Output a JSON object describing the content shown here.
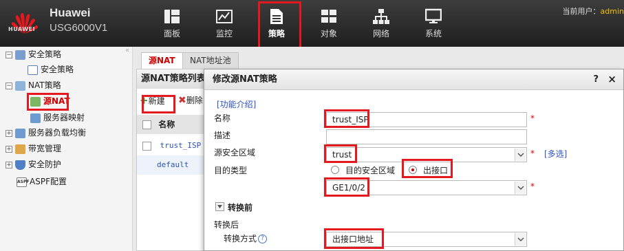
{
  "header": {
    "brand_name": "Huawei",
    "brand_model": "USG6000V1",
    "logo_text": "HUAWEI",
    "current_user_label": "当前用户：",
    "current_user_name": "admin",
    "nav": [
      {
        "label": "面板",
        "icon": "dashboard-icon"
      },
      {
        "label": "监控",
        "icon": "monitor-chart-icon"
      },
      {
        "label": "策略",
        "icon": "policy-document-icon"
      },
      {
        "label": "对象",
        "icon": "objects-icon"
      },
      {
        "label": "网络",
        "icon": "network-icon"
      },
      {
        "label": "系统",
        "icon": "system-computer-icon"
      }
    ],
    "active_nav": "策略",
    "accent_color": "#e41920"
  },
  "sidebar": {
    "collapse_glyph": "«",
    "items": [
      {
        "label": "安全策略",
        "expand": "minus"
      },
      {
        "label": "安全策略"
      },
      {
        "label": "NAT策略",
        "expand": "minus"
      },
      {
        "label": "源NAT"
      },
      {
        "label": "服务器映射"
      },
      {
        "label": "服务器负载均衡",
        "expand": "plus"
      },
      {
        "label": "带宽管理",
        "expand": "plus"
      },
      {
        "label": "安全防护",
        "expand": "plus"
      },
      {
        "label": "ASPF配置",
        "icon_text": "ASPF"
      }
    ]
  },
  "tabs": [
    {
      "label": "源NAT",
      "selected": true
    },
    {
      "label": "NAT地址池",
      "selected": false
    }
  ],
  "list_panel": {
    "title": "源NAT策略列表",
    "new_button": "新建",
    "delete_button": "删除",
    "column_name": "名称",
    "rows": [
      "trust_ISP",
      "default"
    ]
  },
  "dialog": {
    "title": "修改源NAT策略",
    "help_glyph": "?",
    "close_glyph": "×",
    "intro_link": "[功能介绍]",
    "name_label": "名称",
    "name_value": "trust_ISP",
    "desc_label": "描述",
    "desc_value": "",
    "src_zone_label": "源安全区域",
    "src_zone_value": "trust",
    "multi_select_link": "[多选]",
    "dest_type_label": "目的类型",
    "dest_option_zone": "目的安全区域",
    "dest_option_iface": "出接口",
    "dest_selected": "出接口",
    "interface_value": "GE1/0/2",
    "before_section": "转换前",
    "after_section": "转换后",
    "mode_label": "转换方式",
    "mode_value": "出接口地址",
    "required_mark": "*"
  }
}
